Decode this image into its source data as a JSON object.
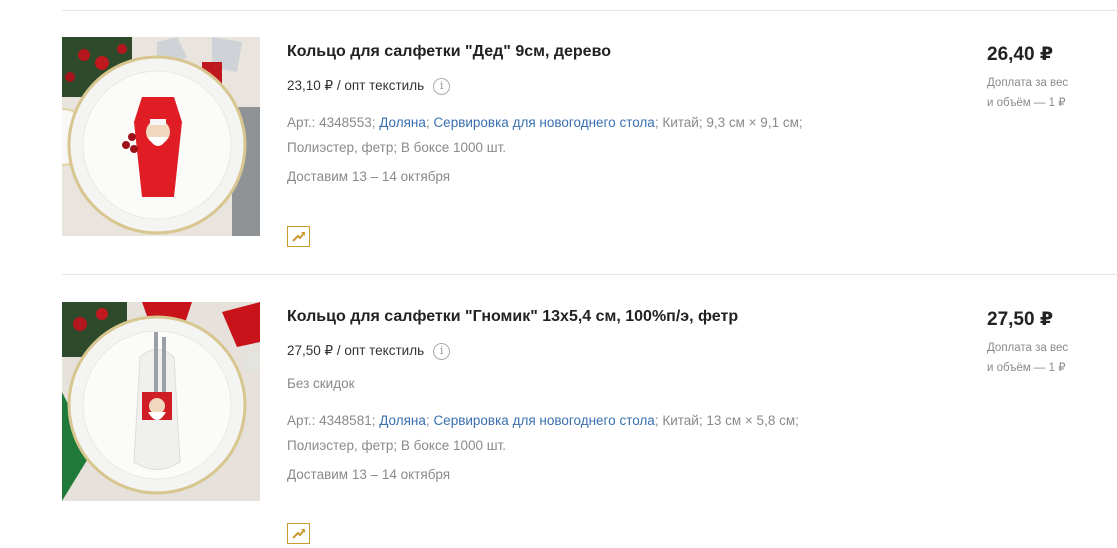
{
  "products": [
    {
      "title": "Кольцо для салфетки \"Дед\" 9см, дерево",
      "opt_price": "23,10 ₽ / опт текстиль",
      "sku": "Арт.: 4348553;",
      "brand": "Доляна",
      "sep1": ";",
      "category": "Сервировка для новогоднего стола",
      "sep2": ";",
      "country": "Китай;",
      "size": "9,3 см × 9,1 см;",
      "material": "Полиэстер, фетр;",
      "box": "В боксе 1000 шт.",
      "delivery": "Доставим 13 – 14 октября",
      "price": "26,40 ₽",
      "surcharge_line1": "Доплата за вес",
      "surcharge_line2": "и объём — 1 ₽",
      "image_icon": "napkin-ring-photo-icon"
    },
    {
      "title": "Кольцо для салфетки \"Гномик\" 13х5,4 см, 100%п/э, фетр",
      "opt_price": "27,50 ₽ / опт текстиль",
      "discount_note": "Без скидок",
      "sku": "Арт.: 4348581;",
      "brand": "Доляна",
      "sep1": ";",
      "category": "Сервировка для новогоднего стола",
      "sep2": ";",
      "country": "Китай;",
      "size": "13 см × 5,8 см;",
      "material": "Полиэстер, фетр;",
      "box": "В боксе 1000 шт.",
      "delivery": "Доставим 13 – 14 октября",
      "price": "27,50 ₽",
      "surcharge_line1": "Доплата за вес",
      "surcharge_line2": "и объём — 1 ₽",
      "image_icon": "napkin-ring-photo-icon"
    }
  ],
  "info_icon_glyph": "i",
  "colors": {
    "link": "#3a6fb0",
    "promo_border": "#c99a2e",
    "muted": "#8a8a8a"
  }
}
